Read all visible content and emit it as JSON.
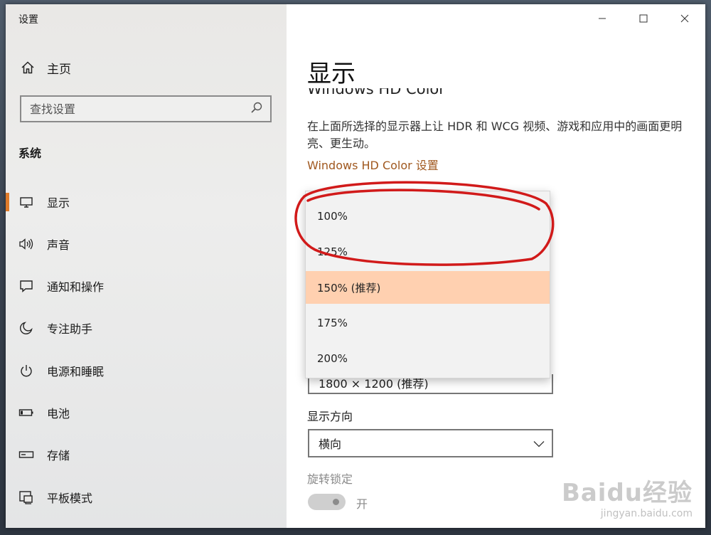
{
  "app": {
    "title": "设置"
  },
  "sidebar": {
    "home_label": "主页",
    "search_placeholder": "查找设置",
    "section_title": "系统",
    "items": [
      {
        "label": "显示",
        "icon": "monitor-icon",
        "active": true
      },
      {
        "label": "声音",
        "icon": "speaker-icon",
        "active": false
      },
      {
        "label": "通知和操作",
        "icon": "notification-icon",
        "active": false
      },
      {
        "label": "专注助手",
        "icon": "moon-icon",
        "active": false
      },
      {
        "label": "电源和睡眠",
        "icon": "power-icon",
        "active": false
      },
      {
        "label": "电池",
        "icon": "battery-icon",
        "active": false
      },
      {
        "label": "存储",
        "icon": "storage-icon",
        "active": false
      },
      {
        "label": "平板模式",
        "icon": "tablet-mode-icon",
        "active": false
      }
    ]
  },
  "window_controls": {
    "minimize": "minimize-icon",
    "maximize": "maximize-icon",
    "close": "close-icon"
  },
  "main": {
    "title": "显示",
    "hd_color_heading": "Windows HD Color",
    "description": "在上面所选择的显示器上让 HDR 和 WCG 视频、游戏和应用中的画面更明亮、更生动。",
    "hd_color_link": "Windows HD Color 设置",
    "scale_dropdown": {
      "options": [
        "100%",
        "125%",
        "150% (推荐)",
        "175%",
        "200%"
      ],
      "selected_index": 2
    },
    "resolution_value": "1800 × 1200 (推荐)",
    "orientation_label": "显示方向",
    "orientation_value": "横向",
    "rotation_lock_label": "旋转锁定",
    "rotation_lock_state": "开"
  },
  "watermark": {
    "logo": "Baidu经验",
    "url": "jingyan.baidu.com"
  },
  "colors": {
    "accent": "#e07b2a",
    "link": "#a0581f",
    "selected_option": "#ffd0b0",
    "annotation": "#d11a1a"
  }
}
